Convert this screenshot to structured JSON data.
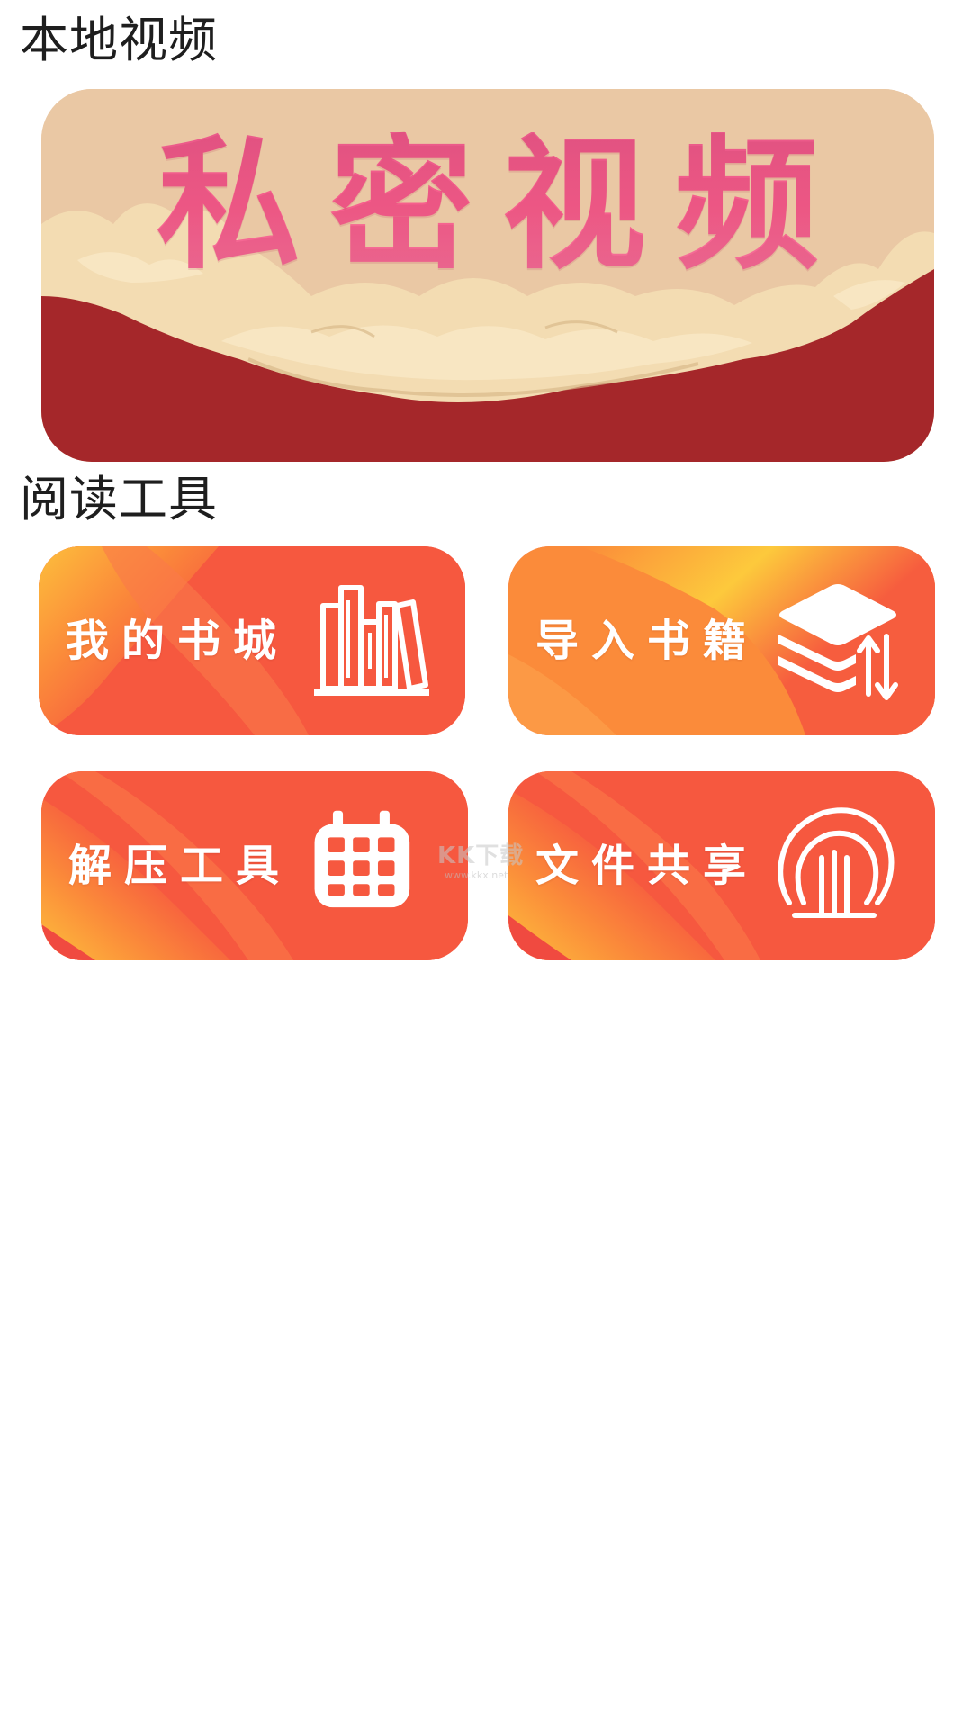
{
  "sections": {
    "local_video": {
      "title": "本地视频"
    },
    "reading_tools": {
      "title": "阅读工具"
    }
  },
  "banner": {
    "text": "私密视频",
    "colors": {
      "background": "#eac8a4",
      "red_band": "#a5272a",
      "cloud": "#f3dcb2",
      "text": "#f65f8d"
    }
  },
  "tools": [
    {
      "label": "我的书城",
      "icon": "bookshelf-icon"
    },
    {
      "label": "导入书籍",
      "icon": "book-stack-transfer-icon"
    },
    {
      "label": "解压工具",
      "icon": "grid-package-icon"
    },
    {
      "label": "文件共享",
      "icon": "file-share-arch-icon"
    }
  ],
  "colors": {
    "card_primary": "#f6583f",
    "card_secondary": "#fb8b3a",
    "card_highlight": "#fdd03c"
  },
  "watermark": {
    "logo": "KK下载",
    "url": "www.kkx.net"
  }
}
